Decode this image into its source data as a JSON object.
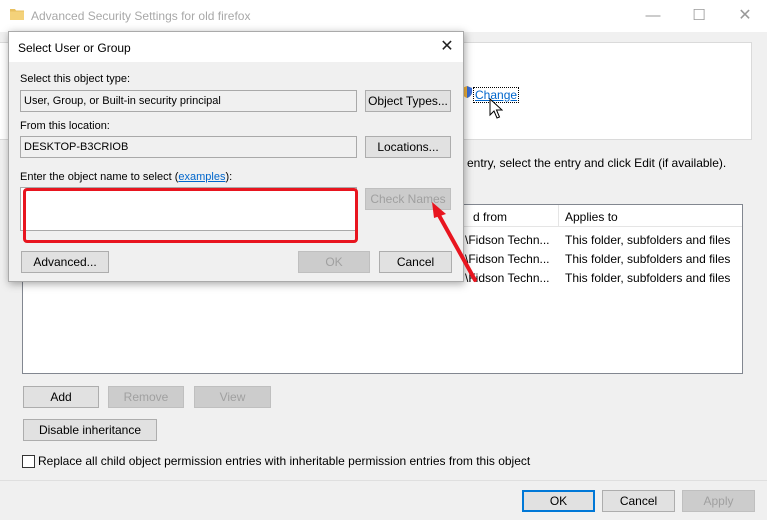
{
  "bg_window": {
    "title": "Advanced Security Settings for old firefox",
    "controls": {
      "minimize": "—",
      "maximize": "☐",
      "close": "✕"
    },
    "owner_change_link": "Change",
    "instructions_fragment": "entry, select the entry and click Edit (if available).",
    "table": {
      "headers": {
        "inherited_from": "d from",
        "applies_to": "Applies to"
      },
      "rows": [
        {
          "inherited": "\\Fidson Techn...",
          "applies": "This folder, subfolders and files"
        },
        {
          "inherited": "\\Fidson Techn...",
          "applies": "This folder, subfolders and files"
        },
        {
          "inherited": "\\Fidson Techn...",
          "applies": "This folder, subfolders and files"
        }
      ]
    },
    "buttons": {
      "add": "Add",
      "remove": "Remove",
      "view": "View",
      "disable_inheritance": "Disable inheritance",
      "ok": "OK",
      "cancel": "Cancel",
      "apply": "Apply"
    },
    "replace_checkbox_label": "Replace all child object permission entries with inheritable permission entries from this object",
    "replace_checked": false
  },
  "dialog": {
    "title": "Select User or Group",
    "close": "✕",
    "object_type_label": "Select this object type:",
    "object_type_value": "User, Group, or Built-in security principal",
    "object_types_button": "Object Types...",
    "location_label": "From this location:",
    "location_value": "DESKTOP-B3CRIOB",
    "locations_button": "Locations...",
    "name_label_prefix": "Enter the object name to select (",
    "name_label_link": "examples",
    "name_label_suffix": "):",
    "name_value": "",
    "check_names_button": "Check Names",
    "advanced_button": "Advanced...",
    "ok_button": "OK",
    "cancel_button": "Cancel"
  },
  "annotations": {
    "highlight_color": "#e8151f",
    "arrow_color": "#e8151f"
  }
}
